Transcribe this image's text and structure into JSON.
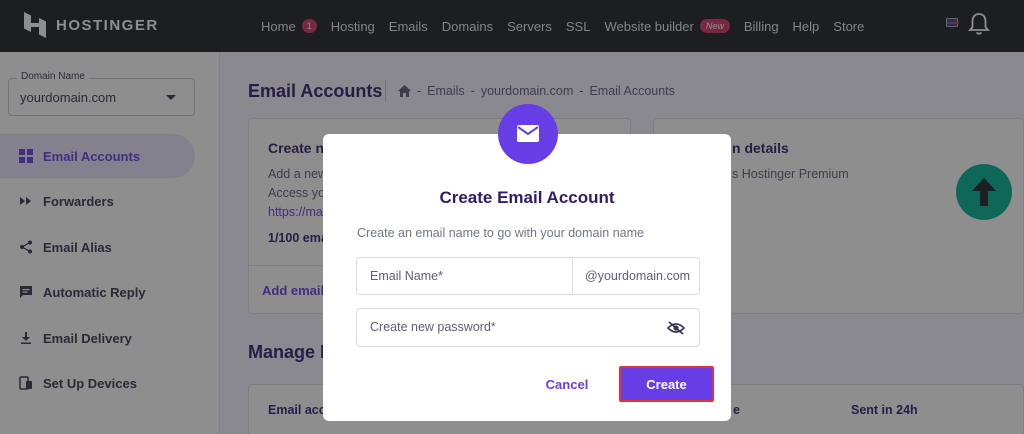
{
  "brand": {
    "name": "HOSTINGER"
  },
  "nav": {
    "items": [
      {
        "label": "Home",
        "badge": "1"
      },
      {
        "label": "Hosting"
      },
      {
        "label": "Emails"
      },
      {
        "label": "Domains"
      },
      {
        "label": "Servers"
      },
      {
        "label": "SSL"
      },
      {
        "label": "Website builder",
        "badge_new": "New"
      },
      {
        "label": "Billing"
      },
      {
        "label": "Help"
      },
      {
        "label": "Store"
      }
    ]
  },
  "sidebar": {
    "domain_label": "Domain Name",
    "domain_value": "yourdomain.com",
    "items": [
      {
        "label": "Email Accounts",
        "icon": "grid-icon",
        "active": true
      },
      {
        "label": "Forwarders",
        "icon": "fast-forward-icon"
      },
      {
        "label": "Email Alias",
        "icon": "share-icon"
      },
      {
        "label": "Automatic Reply",
        "icon": "message-icon"
      },
      {
        "label": "Email Delivery",
        "icon": "download-icon"
      },
      {
        "label": "Set Up Devices",
        "icon": "devices-icon"
      }
    ]
  },
  "main": {
    "title": "Email Accounts",
    "breadcrumb": [
      "Emails",
      "yourdomain.com",
      "Email Accounts"
    ],
    "create_card": {
      "title": "Create n",
      "line1": "Add a new",
      "line2": "Access yo",
      "link": "https://ma",
      "count": "1/100 ema",
      "add_link": "Add email"
    },
    "details_card": {
      "title": "n details",
      "line1": "s Hostinger Premium"
    },
    "manage_title": "Manage E",
    "table_headers": [
      "Email acc",
      "e",
      "Sent in 24h"
    ]
  },
  "modal": {
    "title": "Create Email Account",
    "subtitle": "Create an email name to go with your domain name",
    "email_placeholder": "Email Name*",
    "email_suffix": "@yourdomain.com",
    "password_placeholder": "Create new password*",
    "cancel_label": "Cancel",
    "create_label": "Create"
  },
  "colors": {
    "accent": "#673de6",
    "topbar": "#1d1e20",
    "highlight_border": "#e3342f",
    "scroll_button": "#00b090"
  }
}
